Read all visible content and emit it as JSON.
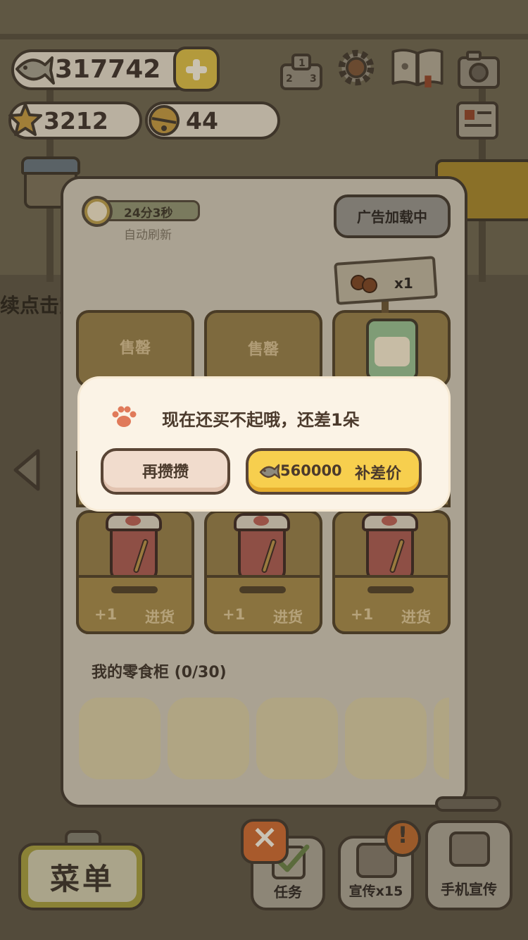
{
  "currency": {
    "fish": "317742",
    "stars": "3212",
    "bells": "44"
  },
  "panel": {
    "timer": "24分3秒",
    "timer_sub": "自动刷新",
    "ad_button": "广告加载中",
    "price_tag_qty": "x1",
    "slots_top": [
      "售罄",
      "售罄"
    ],
    "restock_plus": "+1",
    "restock_label": "进货",
    "snack_title": "我的零食柜 (0/30)"
  },
  "background": {
    "hint_text": "续点击宣"
  },
  "popup": {
    "message": "现在还买不起哦，还差1朵",
    "again_button": "再攒攒",
    "pay_amount": "560000",
    "pay_label": "补差价"
  },
  "bottom_bar": {
    "menu": "菜单",
    "task": "任务",
    "promo": "宣传x15",
    "phone_promo": "手机宣传",
    "alert": "!"
  },
  "colors": {
    "popup_bg": "#fbf3e6",
    "pay_button": "#f7cf4e",
    "again_button": "#f1dccd",
    "dim_overlay": "#4f4838"
  }
}
